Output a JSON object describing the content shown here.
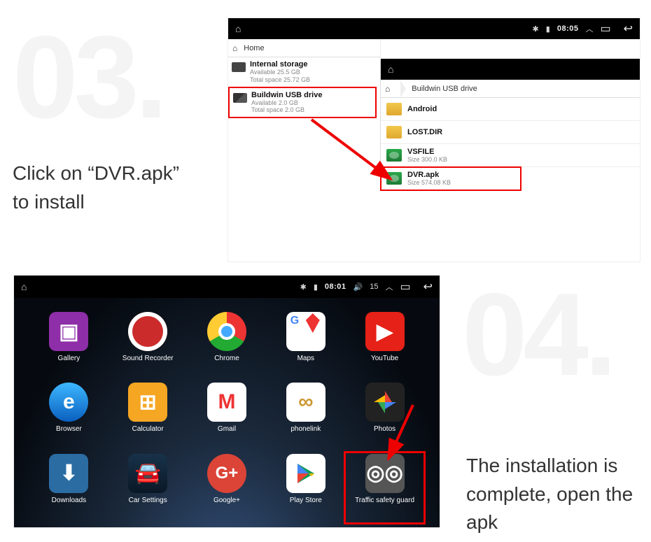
{
  "step03": {
    "number": "03.",
    "text": "Click on  “DVR.apk”\nto install"
  },
  "step04": {
    "number": "04.",
    "text": "The installation is complete, open the apk"
  },
  "panelA": {
    "status": {
      "time": "08:05"
    },
    "crumb_left": "Home",
    "storage": [
      {
        "name": "Internal storage",
        "line1": "Available 25.5 GB",
        "line2": "Total space 25.72 GB"
      },
      {
        "name": "Buildwin USB drive",
        "line1": "Available 2.0 GB",
        "line2": "Total space 2.0 GB"
      }
    ],
    "inset": {
      "crumb": "Buildwin USB drive",
      "files": [
        {
          "type": "folder",
          "name": "Android",
          "sub": ""
        },
        {
          "type": "folder",
          "name": "LOST.DIR",
          "sub": ""
        },
        {
          "type": "apk",
          "name": "VSFILE",
          "sub": "Size 300.0 KB"
        },
        {
          "type": "apk",
          "name": "DVR.apk",
          "sub": "Size 574.08 KB"
        }
      ]
    }
  },
  "panelB": {
    "status": {
      "time": "08:01",
      "extra": "15"
    },
    "apps": [
      {
        "key": "gallery",
        "label": "Gallery"
      },
      {
        "key": "recorder",
        "label": "Sound Recorder"
      },
      {
        "key": "chrome",
        "label": "Chrome"
      },
      {
        "key": "maps",
        "label": "Maps"
      },
      {
        "key": "youtube",
        "label": "YouTube"
      },
      {
        "key": "browser",
        "label": "Browser"
      },
      {
        "key": "calc",
        "label": "Calculator"
      },
      {
        "key": "gmail",
        "label": "Gmail"
      },
      {
        "key": "phonelink",
        "label": "phonelink"
      },
      {
        "key": "photos",
        "label": "Photos"
      },
      {
        "key": "downloads",
        "label": "Downloads"
      },
      {
        "key": "carset",
        "label": "Car Settings"
      },
      {
        "key": "gplus",
        "label": "Google+"
      },
      {
        "key": "playstore",
        "label": "Play Store"
      },
      {
        "key": "traffic",
        "label": "Traffic safety guard"
      }
    ]
  }
}
